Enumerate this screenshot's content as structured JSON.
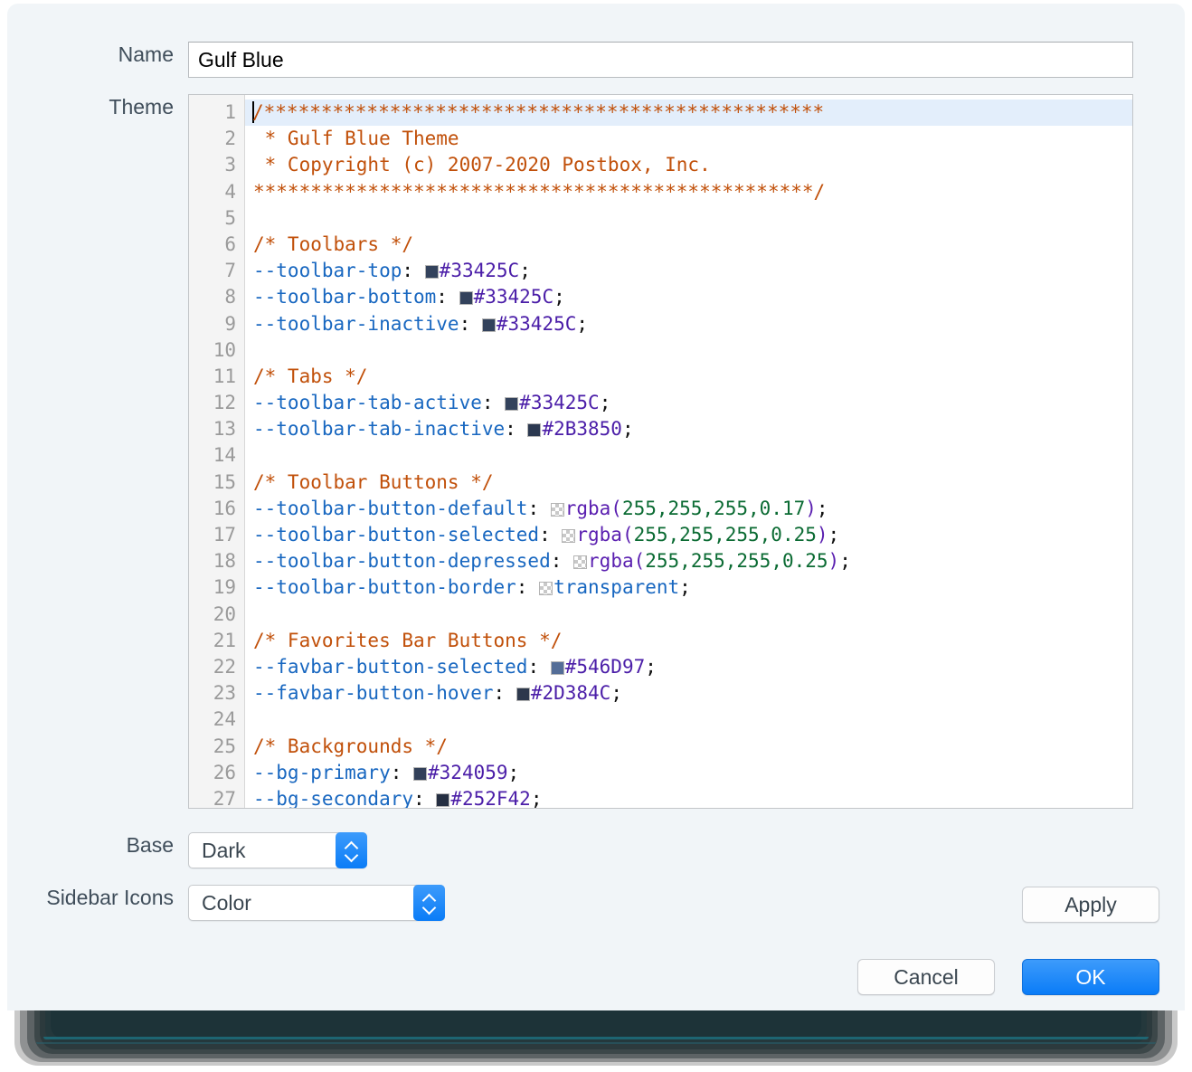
{
  "dialog": {
    "fields": {
      "name_label": "Name",
      "theme_label": "Theme",
      "base_label": "Base",
      "sidebar_icons_label": "Sidebar Icons"
    },
    "name_value": "Gulf Blue",
    "name_placeholder": "",
    "base_value": "Dark",
    "sidebar_icons_value": "Color",
    "buttons": {
      "apply": "Apply",
      "cancel": "Cancel",
      "ok": "OK"
    },
    "accent_color": "#0a7cf7"
  },
  "editor": {
    "line_numbers": [
      "1",
      "2",
      "3",
      "4",
      "5",
      "6",
      "7",
      "8",
      "9",
      "10",
      "11",
      "12",
      "13",
      "14",
      "15",
      "16",
      "17",
      "18",
      "19",
      "20",
      "21",
      "22",
      "23",
      "24",
      "25",
      "26",
      "27"
    ],
    "active_line": 1,
    "lines": [
      {
        "n": 1,
        "text": "/*************************************************"
      },
      {
        "n": 2,
        "text": " * Gulf Blue Theme"
      },
      {
        "n": 3,
        "text": " * Copyright (c) 2007-2020 Postbox, Inc."
      },
      {
        "n": 4,
        "text": "*************************************************/"
      },
      {
        "n": 5,
        "text": ""
      },
      {
        "n": 6,
        "text": "/* Toolbars */"
      },
      {
        "n": 7,
        "text": "--toolbar-top:  #33425C;"
      },
      {
        "n": 8,
        "text": "--toolbar-bottom:  #33425C;"
      },
      {
        "n": 9,
        "text": "--toolbar-inactive:  #33425C;"
      },
      {
        "n": 10,
        "text": ""
      },
      {
        "n": 11,
        "text": "/* Tabs */"
      },
      {
        "n": 12,
        "text": "--toolbar-tab-active:  #33425C;"
      },
      {
        "n": 13,
        "text": "--toolbar-tab-inactive:  #2B3850;"
      },
      {
        "n": 14,
        "text": ""
      },
      {
        "n": 15,
        "text": "/* Toolbar Buttons */"
      },
      {
        "n": 16,
        "text": "--toolbar-button-default:  rgba(255,255,255,0.17);"
      },
      {
        "n": 17,
        "text": "--toolbar-button-selected:  rgba(255,255,255,0.25);"
      },
      {
        "n": 18,
        "text": "--toolbar-button-depressed:  rgba(255,255,255,0.25);"
      },
      {
        "n": 19,
        "text": "--toolbar-button-border:  transparent;"
      },
      {
        "n": 20,
        "text": ""
      },
      {
        "n": 21,
        "text": "/* Favorites Bar Buttons */"
      },
      {
        "n": 22,
        "text": "--favbar-button-selected:  #546D97;"
      },
      {
        "n": 23,
        "text": "--favbar-button-hover:  #2D384C;"
      },
      {
        "n": 24,
        "text": ""
      },
      {
        "n": 25,
        "text": "/* Backgrounds */"
      },
      {
        "n": 26,
        "text": "--bg-primary:  #324059;"
      },
      {
        "n": 27,
        "text": "--bg-secondary:  #252F42;"
      }
    ],
    "comments": {
      "header_line1": "/*************************************************",
      "header_line2": " * Gulf Blue Theme",
      "header_line3": " * Copyright (c) 2007-2020 Postbox, Inc.",
      "header_line4": "*************************************************/",
      "toolbars": "/* Toolbars */",
      "tabs": "/* Tabs */",
      "toolbar_buttons": "/* Toolbar Buttons */",
      "favorites_bar_buttons": "/* Favorites Bar Buttons */",
      "backgrounds": "/* Backgrounds */"
    },
    "properties": [
      {
        "name": "--toolbar-top",
        "value": "#33425C",
        "swatch": "#33425C"
      },
      {
        "name": "--toolbar-bottom",
        "value": "#33425C",
        "swatch": "#33425C"
      },
      {
        "name": "--toolbar-inactive",
        "value": "#33425C",
        "swatch": "#33425C"
      },
      {
        "name": "--toolbar-tab-active",
        "value": "#33425C",
        "swatch": "#33425C"
      },
      {
        "name": "--toolbar-tab-inactive",
        "value": "#2B3850",
        "swatch": "#2B3850"
      },
      {
        "name": "--toolbar-button-default",
        "value": "rgba(255,255,255,0.17)",
        "swatch": "alpha"
      },
      {
        "name": "--toolbar-button-selected",
        "value": "rgba(255,255,255,0.25)",
        "swatch": "alpha"
      },
      {
        "name": "--toolbar-button-depressed",
        "value": "rgba(255,255,255,0.25)",
        "swatch": "alpha"
      },
      {
        "name": "--toolbar-button-border",
        "value": "transparent",
        "swatch": "alpha"
      },
      {
        "name": "--favbar-button-selected",
        "value": "#546D97",
        "swatch": "#546D97"
      },
      {
        "name": "--favbar-button-hover",
        "value": "#2D384C",
        "swatch": "#2D384C"
      },
      {
        "name": "--bg-primary",
        "value": "#324059",
        "swatch": "#324059"
      },
      {
        "name": "--bg-secondary",
        "value": "#252F42",
        "swatch": "#252F42"
      }
    ]
  }
}
